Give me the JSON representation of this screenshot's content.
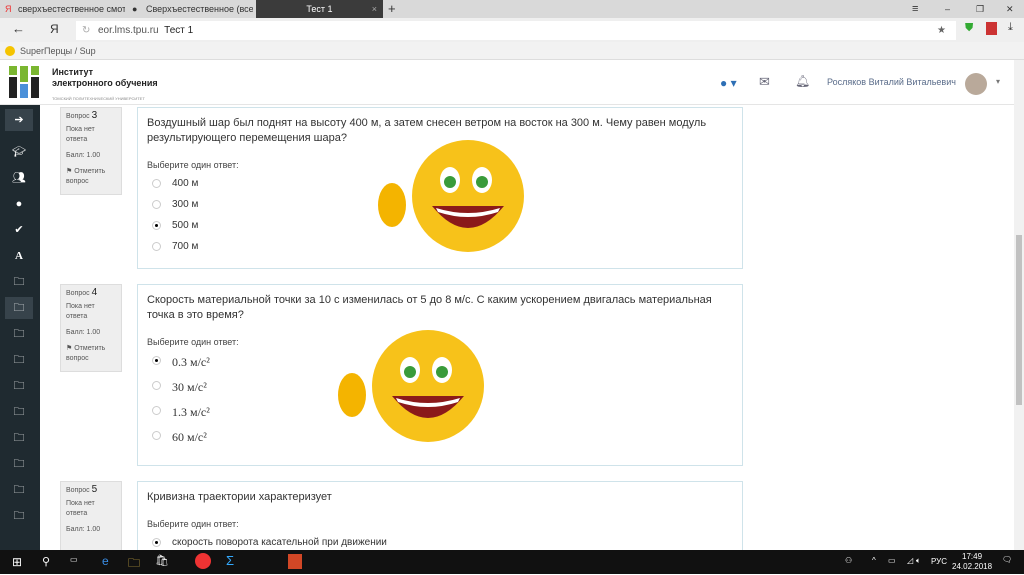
{
  "browser": {
    "tabs": [
      {
        "label": "сверхъестественное смотр"
      },
      {
        "label": "Сверхъестественное (все с"
      },
      {
        "label": "Тест 1"
      }
    ],
    "url_domain": "eor.lms.tpu.ru",
    "url_title": "Тест 1",
    "bookmark": "SuperПерцы / Sup"
  },
  "header": {
    "org_line1": "Институт",
    "org_line2": "электронного обучения",
    "org_sub": "ТОМСКИЙ ПОЛИТЕХНИЧЕСКИЙ УНИВЕРСИТЕТ",
    "user_name": "Росляков Виталий Витальевич"
  },
  "questions": [
    {
      "label": "Вопрос",
      "num": "3",
      "status": "Пока нет ответа",
      "score": "Балл: 1.00",
      "flag": "Отметить вопрос",
      "text": "Воздушный шар был поднят на высоту 400 м, а затем снесен ветром на восток на 300 м. Чему равен модуль результирующего перемещения шара?",
      "prompt": "Выберите один ответ:",
      "options": [
        "400 м",
        "300 м",
        "500 м",
        "700 м"
      ],
      "selected": 2
    },
    {
      "label": "Вопрос",
      "num": "4",
      "status": "Пока нет ответа",
      "score": "Балл: 1.00",
      "flag": "Отметить вопрос",
      "text": "Скорость материальной точки за 10 с изменилась от 5 до 8 м/с. С каким ускорением двигалась материальная точка в это время?",
      "prompt": "Выберите один ответ:",
      "options": [
        "0.3  м/с²",
        "30  м/с²",
        "1.3  м/с²",
        "60  м/с²"
      ],
      "selected": 0
    },
    {
      "label": "Вопрос",
      "num": "5",
      "status": "Пока нет ответа",
      "score": "Балл: 1.00",
      "text": "Кривизна траектории характеризует",
      "prompt": "Выберите один ответ:",
      "options": [
        "скорость поворота касательной при движении"
      ],
      "selected": 0
    }
  ],
  "taskbar": {
    "lang": "РУС",
    "time": "17:49",
    "date": "24.02.2018"
  }
}
